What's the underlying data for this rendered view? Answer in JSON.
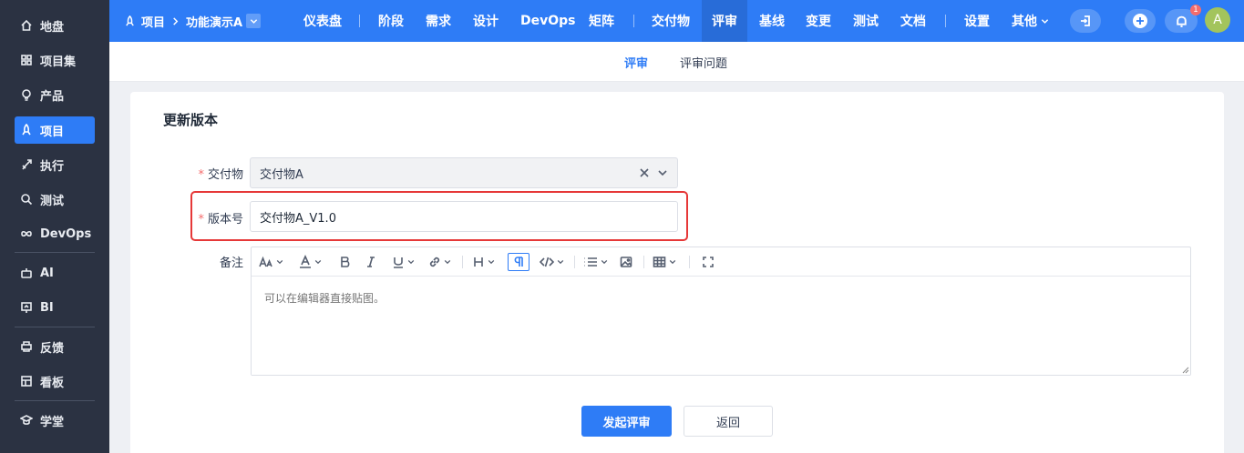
{
  "sidebar": {
    "items": [
      {
        "label": "地盘",
        "icon": "home-icon"
      },
      {
        "label": "项目集",
        "icon": "grid-icon"
      },
      {
        "label": "产品",
        "icon": "bulb-icon"
      },
      {
        "label": "项目",
        "icon": "rocket-icon",
        "active": true
      },
      {
        "label": "执行",
        "icon": "run-icon"
      },
      {
        "label": "测试",
        "icon": "search-bug-icon"
      },
      {
        "label": "DevOps",
        "icon": "infinity-icon"
      },
      {
        "label": "AI",
        "icon": "robot-icon"
      },
      {
        "label": "BI",
        "icon": "chart-board-icon"
      },
      {
        "label": "反馈",
        "icon": "printer-icon"
      },
      {
        "label": "看板",
        "icon": "kanban-icon"
      },
      {
        "label": "学堂",
        "icon": "school-icon"
      }
    ]
  },
  "topbar": {
    "breadcrumb_root": "项目",
    "breadcrumb_project": "功能演示A",
    "nav": [
      "仪表盘",
      "阶段",
      "需求",
      "设计",
      "DevOps",
      "矩阵",
      "交付物",
      "评审",
      "基线",
      "变更",
      "测试",
      "文档",
      "设置",
      "其他"
    ],
    "active_nav": "评审",
    "notification_count": "1",
    "avatar_letter": "A"
  },
  "subtabs": {
    "review": "评审",
    "review_issues": "评审问题"
  },
  "form": {
    "title": "更新版本",
    "deliverable_label": "交付物",
    "deliverable_value": "交付物A",
    "version_label": "版本号",
    "version_value": "交付物A_V1.0",
    "remark_label": "备注",
    "remark_placeholder": "可以在编辑器直接贴图。",
    "submit_label": "发起评审",
    "back_label": "返回",
    "required_mark": "*"
  },
  "colors": {
    "accent": "#2e7cf6",
    "sidebar_bg": "#2b3242",
    "highlight": "#e63838"
  }
}
